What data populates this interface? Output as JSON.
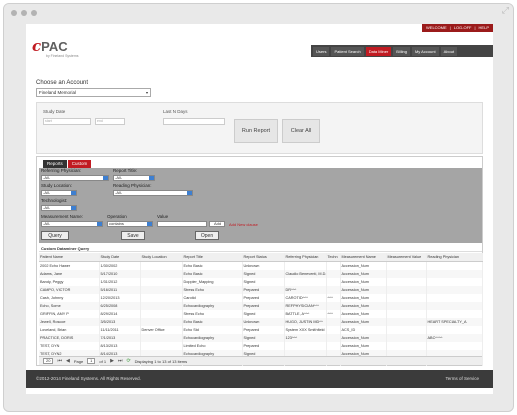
{
  "top_links": [
    "WELCOME",
    "LOG-OFF",
    "HELP"
  ],
  "brand": {
    "logo_c": "c",
    "logo_rest": "PAC",
    "tagline": "by Fineland Systems"
  },
  "nav": [
    "Users",
    "Patient Search",
    "Data Miner",
    "Billing",
    "My Account",
    "About"
  ],
  "nav_active": "Data Miner",
  "account": {
    "label": "Choose an Account",
    "selected": "Fineland Memorial"
  },
  "filters": {
    "study_date_label": "Study Date",
    "study_date_from": "start",
    "study_date_to": "end",
    "last_n_days_label": "Last N Days",
    "run_report": "Run Report",
    "clear_all": "Clear All"
  },
  "tabs": [
    "Reports",
    "Custom"
  ],
  "query": {
    "referring_physician_label": "Referring Physician:",
    "referring_physician_value": "-All-",
    "report_title_label": "Report Title:",
    "report_title_value": "-All-",
    "study_location_label": "Study Location:",
    "study_location_value": "-All-",
    "reading_physician_label": "Reading Physician:",
    "reading_physician_value": "-All-",
    "technologist_label": "Technologist:",
    "technologist_value": "-All-",
    "measurement_name_label": "Measurement Name:",
    "measurement_name_value": "-All-",
    "operation_label": "Operation",
    "operation_value": "contains",
    "value_label": "Value",
    "add_label": "Add",
    "add_hint": "Add New clause",
    "query_btn": "Query",
    "save_btn": "Save",
    "open_btn": "Open"
  },
  "results": {
    "title": "Custom Dataminer Query",
    "columns": [
      "Patient Name",
      "Study Date",
      "Study Location",
      "Report Title",
      "Report Status",
      "Referring Physician",
      "Techn",
      "Measurement Name",
      "Measurement Value",
      "Reading Physician"
    ],
    "rows": [
      [
        "2002 Echo Hawer",
        "1/30/2002",
        "",
        "Echo Basic",
        "Unknown",
        "",
        "",
        "Accession_Num",
        "",
        ""
      ],
      [
        "Adams, Jane",
        "5/17/2010",
        "",
        "Echo Basic",
        "Signed",
        "Claudio Beneventi, M.D.",
        "",
        "Accession_Num",
        "",
        ""
      ],
      [
        "Bandy, Peggy",
        "1/31/2012",
        "",
        "Doppler_Mapping",
        "Signed",
        "",
        "",
        "Accession_Num",
        "",
        ""
      ],
      [
        "CAMPO, VICTOR",
        "5/16/2011",
        "",
        "Stress Echo",
        "Prepared",
        "DR^^^",
        "",
        "Accession_Num",
        "",
        ""
      ],
      [
        "Cash, Johnny",
        "12/20/2013",
        "",
        "Carotid",
        "Prepared",
        "CAROTID^^^",
        "^^^",
        "Accession_Num",
        "",
        ""
      ],
      [
        "Echo, Some",
        "6/25/2008",
        "",
        "Echocardiography",
        "Prepared",
        "REFPHYSICIAN^^^",
        "",
        "Accession_Num",
        "",
        ""
      ],
      [
        "GRIFFIN, AMY P",
        "8/29/2014",
        "",
        "Stress Echo",
        "Signed",
        "BATTLE, A^^^",
        "^^^",
        "Accession_Num",
        "",
        ""
      ],
      [
        "Jewell, Roscoe",
        "3/5/2013",
        "",
        "Echo Basic",
        "Unknown",
        "HUGO, JUSTIN MD^^",
        "",
        "Accession_Num",
        "",
        "HEART SPECIALTY_A"
      ],
      [
        "Loveland, Brian",
        "11/11/2011",
        "Denver Office",
        "Echo Std",
        "Prepared",
        "System XXX Smithfield",
        "",
        "ACS_ID",
        "",
        ""
      ],
      [
        "PRACTICE, DORIS",
        "7/1/2013",
        "",
        "Echocardiography",
        "Signed",
        "123^^^",
        "",
        "Accession_Num",
        "",
        "ABC^^^^"
      ],
      [
        "TEST, DYN",
        "8/13/2013",
        "",
        "Limited Echo",
        "Prepared",
        "",
        "",
        "Accession_Num",
        "",
        ""
      ],
      [
        "TEST, DYN2",
        "8/14/2013",
        "",
        "Echocardiography",
        "Signed",
        "",
        "",
        "Accession_Num",
        "",
        ""
      ],
      [
        "TESTVIVINGLE, TWINS",
        "7/1/2011",
        "",
        "DB_Single Fetus",
        "Signed",
        "BESTER^DR^^^",
        "^^^",
        "A_AFI_AFI",
        "0.0",
        "test^^^"
      ]
    ]
  },
  "pager": {
    "page_size": "20",
    "page_label": "Page",
    "page_value": "1",
    "of_label": "of 1",
    "display": "Displaying 1 to 13 of 13 items"
  },
  "footer": {
    "copyright": "©2012-2014 Fineland Systems. All Rights Reserved.",
    "terms": "Terms of Service"
  }
}
